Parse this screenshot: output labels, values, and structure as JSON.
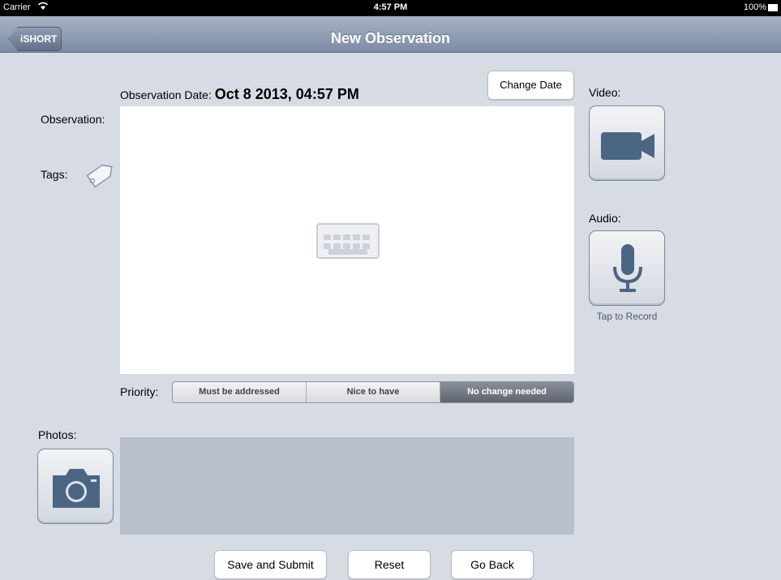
{
  "status_bar": {
    "carrier": "Carrier",
    "wifi_icon": "wifi-icon",
    "time": "4:57 PM",
    "battery": "100%"
  },
  "nav": {
    "back_label": "iSHORT",
    "title": "New Observation"
  },
  "form": {
    "obs_date_label": "Observation Date:",
    "obs_date_value": "Oct 8 2013, 04:57 PM",
    "change_date_label": "Change Date",
    "observation_label": "Observation:",
    "tags_label": "Tags:",
    "video_label": "Video:",
    "audio_label": "Audio:",
    "tap_to_record": "Tap to Record",
    "priority_label": "Priority:",
    "priority_options": [
      "Must be addressed",
      "Nice to have",
      "No change needed"
    ],
    "priority_selected": "No change needed",
    "photos_label": "Photos:"
  },
  "buttons": {
    "save": "Save and Submit",
    "reset": "Reset",
    "back": "Go Back"
  },
  "colors": {
    "background": "#d7dbe3",
    "nav_top": "#a6b3c6",
    "nav_bottom": "#7d8ca5",
    "icon_slate": "#4b6584",
    "photo_area": "#b8bfcb",
    "selected_segment": "#5f6570"
  }
}
